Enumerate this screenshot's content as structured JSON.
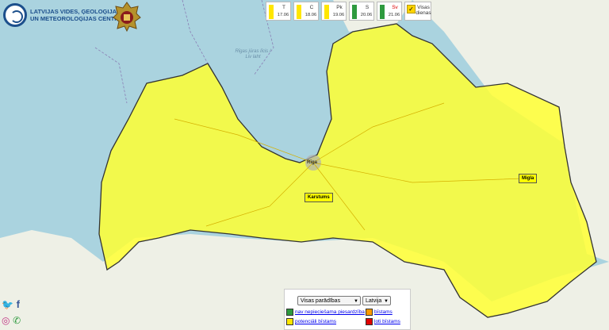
{
  "header": {
    "org_name_line1": "LATVIJAS VIDES, ĢEOLOĢIJAS",
    "org_name_line2": "UN METEOROLOĢIJAS CENTRS"
  },
  "days": [
    {
      "name": "T",
      "date": "17.06",
      "color": "#ffe600"
    },
    {
      "name": "C",
      "date": "18.06",
      "color": "#ffe600"
    },
    {
      "name": "Pk",
      "date": "19.06",
      "color": "#ffe600"
    },
    {
      "name": "S",
      "date": "20.06",
      "color": "#2e9a3e"
    },
    {
      "name": "Sv",
      "date": "21.06",
      "color": "#2e9a3e"
    }
  ],
  "all_days": {
    "label": "Visas dienas",
    "check": "✓"
  },
  "map": {
    "sea_label": "Rīgas jūras līcis / Liv laht",
    "riga_label": "Rīga",
    "warnings": [
      {
        "label": "Karstums"
      },
      {
        "label": "Migla"
      }
    ],
    "colors": {
      "sea": "#aad3df",
      "land": "#eef0e6",
      "warning_area": "#ffff33",
      "border": "#333333"
    }
  },
  "controls": {
    "warning_filter": "Visas parādības",
    "region_filter": "Latvija",
    "legend": [
      {
        "label": "nav nepieciešama piesardzība",
        "color": "#2e9a3e"
      },
      {
        "label": "bīstams",
        "color": "#ff9900"
      },
      {
        "label": "potenciāli bīstams",
        "color": "#ffe600"
      },
      {
        "label": "ļoti bīstams",
        "color": "#e00000"
      }
    ]
  },
  "social": {
    "twitter_glyph": "🐦",
    "facebook_glyph": "f",
    "instagram_glyph": "◎",
    "phone_glyph": "✆"
  }
}
